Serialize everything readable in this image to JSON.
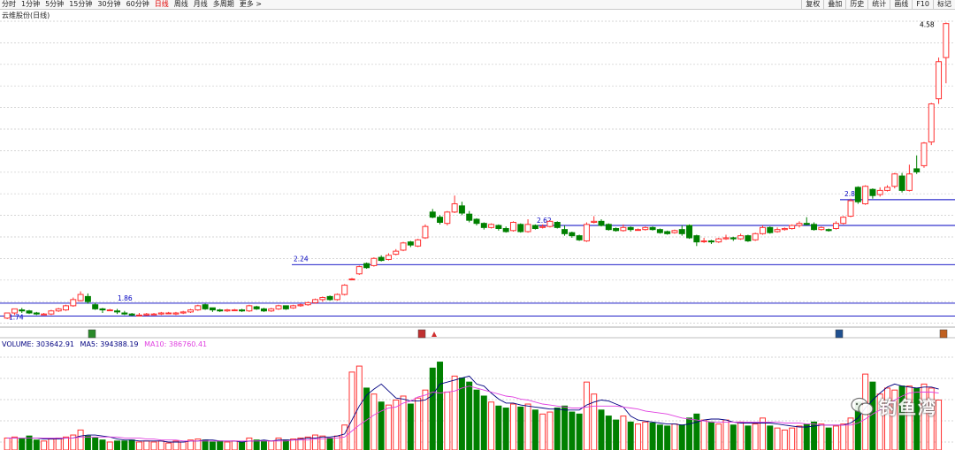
{
  "toolbar": {
    "periods": [
      "分时",
      "1分钟",
      "5分钟",
      "15分钟",
      "30分钟",
      "60分钟",
      "日线",
      "周线",
      "月线",
      "多周期",
      "更多 >"
    ],
    "active_period": "日线",
    "right_buttons": [
      "复权",
      "叠加",
      "历史",
      "统计",
      "画线",
      "F10",
      "标记"
    ]
  },
  "stock_title": "云维股份(日线)",
  "volume_legend": {
    "volume": "VOLUME: 303642.91",
    "ma5": "MA5: 394388.19",
    "ma10": "MA10: 386760.41"
  },
  "colors": {
    "up": "#ff3030",
    "down": "#008000",
    "level_line": "#0000c0",
    "ma5": "#000080",
    "ma10": "#e040e0",
    "grid": "#c8c8c8"
  },
  "watermark": "钓鱼湾",
  "chart_data": {
    "type": "candlestick",
    "title": "云维股份(日线)",
    "ylim": [
      1.65,
      4.62
    ],
    "price_annotations": [
      {
        "label": "1.74",
        "value": 1.74
      },
      {
        "label": "1.86",
        "value": 1.865
      },
      {
        "label": "2.24",
        "value": 2.24
      },
      {
        "label": "2.62",
        "value": 2.62
      },
      {
        "label": "2.88",
        "value": 2.87
      },
      {
        "label": "4.58",
        "value": 4.58
      }
    ],
    "candles": [
      [
        1.72,
        1.77,
        1.76,
        1.71
      ],
      [
        1.77,
        1.81,
        1.79,
        1.75
      ],
      [
        1.8,
        1.79,
        1.82,
        1.77
      ],
      [
        1.79,
        1.77,
        1.8,
        1.76
      ],
      [
        1.77,
        1.76,
        1.78,
        1.75
      ],
      [
        1.76,
        1.76,
        1.77,
        1.75
      ],
      [
        1.76,
        1.79,
        1.8,
        1.75
      ],
      [
        1.79,
        1.81,
        1.82,
        1.78
      ],
      [
        1.8,
        1.84,
        1.85,
        1.79
      ],
      [
        1.84,
        1.9,
        1.92,
        1.83
      ],
      [
        1.89,
        1.95,
        1.98,
        1.88
      ],
      [
        1.93,
        1.88,
        1.96,
        1.86
      ],
      [
        1.85,
        1.81,
        1.87,
        1.8
      ],
      [
        1.81,
        1.8,
        1.82,
        1.77
      ],
      [
        1.8,
        1.8,
        1.81,
        1.79
      ],
      [
        1.79,
        1.78,
        1.81,
        1.76
      ],
      [
        1.77,
        1.76,
        1.79,
        1.75
      ],
      [
        1.76,
        1.75,
        1.77,
        1.74
      ],
      [
        1.75,
        1.75,
        1.77,
        1.74
      ],
      [
        1.75,
        1.76,
        1.77,
        1.74
      ],
      [
        1.76,
        1.76,
        1.77,
        1.75
      ],
      [
        1.76,
        1.77,
        1.78,
        1.75
      ],
      [
        1.77,
        1.77,
        1.78,
        1.76
      ],
      [
        1.76,
        1.77,
        1.78,
        1.75
      ],
      [
        1.77,
        1.78,
        1.79,
        1.76
      ],
      [
        1.78,
        1.8,
        1.81,
        1.77
      ],
      [
        1.8,
        1.84,
        1.85,
        1.79
      ],
      [
        1.85,
        1.81,
        1.86,
        1.8
      ],
      [
        1.82,
        1.8,
        1.82,
        1.78
      ],
      [
        1.8,
        1.79,
        1.81,
        1.78
      ],
      [
        1.79,
        1.8,
        1.81,
        1.78
      ],
      [
        1.8,
        1.8,
        1.81,
        1.79
      ],
      [
        1.8,
        1.79,
        1.81,
        1.78
      ],
      [
        1.79,
        1.84,
        1.85,
        1.78
      ],
      [
        1.83,
        1.81,
        1.84,
        1.8
      ],
      [
        1.81,
        1.79,
        1.82,
        1.78
      ],
      [
        1.79,
        1.81,
        1.82,
        1.78
      ],
      [
        1.81,
        1.84,
        1.85,
        1.8
      ],
      [
        1.84,
        1.81,
        1.84,
        1.8
      ],
      [
        1.82,
        1.84,
        1.85,
        1.81
      ],
      [
        1.84,
        1.85,
        1.86,
        1.83
      ],
      [
        1.85,
        1.87,
        1.88,
        1.84
      ],
      [
        1.87,
        1.9,
        1.91,
        1.86
      ],
      [
        1.9,
        1.92,
        1.93,
        1.88
      ],
      [
        1.93,
        1.9,
        1.94,
        1.89
      ],
      [
        1.9,
        1.95,
        1.96,
        1.89
      ],
      [
        1.95,
        2.04,
        2.05,
        1.94
      ],
      [
        2.1,
        2.1,
        2.11,
        2.09
      ],
      [
        2.15,
        2.22,
        2.23,
        2.14
      ],
      [
        2.25,
        2.21,
        2.26,
        2.2
      ],
      [
        2.23,
        2.3,
        2.31,
        2.22
      ],
      [
        2.31,
        2.28,
        2.33,
        2.27
      ],
      [
        2.29,
        2.33,
        2.35,
        2.28
      ],
      [
        2.34,
        2.37,
        2.39,
        2.33
      ],
      [
        2.38,
        2.45,
        2.46,
        2.37
      ],
      [
        2.46,
        2.43,
        2.47,
        2.41
      ],
      [
        2.42,
        2.48,
        2.49,
        2.41
      ],
      [
        2.5,
        2.61,
        2.63,
        2.49
      ],
      [
        2.75,
        2.7,
        2.78,
        2.69
      ],
      [
        2.7,
        2.65,
        2.72,
        2.63
      ],
      [
        2.64,
        2.75,
        2.76,
        2.62
      ],
      [
        2.75,
        2.83,
        2.91,
        2.74
      ],
      [
        2.81,
        2.74,
        2.85,
        2.72
      ],
      [
        2.73,
        2.67,
        2.76,
        2.65
      ],
      [
        2.68,
        2.64,
        2.69,
        2.62
      ],
      [
        2.64,
        2.6,
        2.65,
        2.58
      ],
      [
        2.6,
        2.63,
        2.64,
        2.59
      ],
      [
        2.62,
        2.59,
        2.63,
        2.57
      ],
      [
        2.59,
        2.56,
        2.61,
        2.55
      ],
      [
        2.57,
        2.65,
        2.66,
        2.56
      ],
      [
        2.63,
        2.56,
        2.64,
        2.55
      ],
      [
        2.56,
        2.63,
        2.68,
        2.55
      ],
      [
        2.62,
        2.59,
        2.63,
        2.58
      ],
      [
        2.6,
        2.61,
        2.63,
        2.59
      ],
      [
        2.61,
        2.66,
        2.67,
        2.6
      ],
      [
        2.65,
        2.6,
        2.66,
        2.59
      ],
      [
        2.58,
        2.54,
        2.62,
        2.52
      ],
      [
        2.55,
        2.52,
        2.56,
        2.5
      ],
      [
        2.52,
        2.48,
        2.53,
        2.47
      ],
      [
        2.47,
        2.63,
        2.65,
        2.46
      ],
      [
        2.65,
        2.66,
        2.71,
        2.64
      ],
      [
        2.66,
        2.62,
        2.68,
        2.61
      ],
      [
        2.63,
        2.58,
        2.64,
        2.57
      ],
      [
        2.59,
        2.57,
        2.6,
        2.56
      ],
      [
        2.57,
        2.6,
        2.63,
        2.56
      ],
      [
        2.6,
        2.58,
        2.61,
        2.56
      ],
      [
        2.58,
        2.58,
        2.59,
        2.57
      ],
      [
        2.58,
        2.6,
        2.61,
        2.57
      ],
      [
        2.6,
        2.58,
        2.61,
        2.57
      ],
      [
        2.58,
        2.55,
        2.59,
        2.54
      ],
      [
        2.56,
        2.54,
        2.57,
        2.53
      ],
      [
        2.55,
        2.57,
        2.58,
        2.54
      ],
      [
        2.58,
        2.54,
        2.62,
        2.52
      ],
      [
        2.62,
        2.5,
        2.63,
        2.49
      ],
      [
        2.52,
        2.46,
        2.53,
        2.42
      ],
      [
        2.47,
        2.47,
        2.5,
        2.45
      ],
      [
        2.47,
        2.46,
        2.48,
        2.44
      ],
      [
        2.46,
        2.49,
        2.5,
        2.45
      ],
      [
        2.49,
        2.5,
        2.53,
        2.48
      ],
      [
        2.5,
        2.49,
        2.51,
        2.47
      ],
      [
        2.49,
        2.52,
        2.54,
        2.48
      ],
      [
        2.52,
        2.47,
        2.53,
        2.46
      ],
      [
        2.48,
        2.54,
        2.55,
        2.47
      ],
      [
        2.54,
        2.6,
        2.62,
        2.53
      ],
      [
        2.6,
        2.55,
        2.61,
        2.54
      ],
      [
        2.56,
        2.58,
        2.6,
        2.55
      ],
      [
        2.58,
        2.59,
        2.6,
        2.57
      ],
      [
        2.59,
        2.62,
        2.63,
        2.58
      ],
      [
        2.62,
        2.64,
        2.66,
        2.6
      ],
      [
        2.64,
        2.63,
        2.7,
        2.62
      ],
      [
        2.63,
        2.58,
        2.65,
        2.57
      ],
      [
        2.58,
        2.6,
        2.61,
        2.57
      ],
      [
        2.58,
        2.57,
        2.59,
        2.56
      ],
      [
        2.59,
        2.64,
        2.66,
        2.58
      ],
      [
        2.64,
        2.7,
        2.71,
        2.63
      ],
      [
        2.71,
        2.86,
        2.88,
        2.7
      ],
      [
        2.99,
        2.85,
        3.0,
        2.83
      ],
      [
        2.83,
        3.0,
        3.01,
        2.82
      ],
      [
        2.97,
        2.91,
        2.98,
        2.88
      ],
      [
        2.92,
        2.96,
        2.99,
        2.9
      ],
      [
        2.96,
        2.99,
        3.01,
        2.95
      ],
      [
        3.0,
        3.12,
        3.13,
        2.98
      ],
      [
        3.1,
        2.96,
        3.13,
        2.94
      ],
      [
        2.96,
        3.12,
        3.21,
        2.95
      ],
      [
        3.17,
        3.14,
        3.3,
        3.12
      ],
      [
        3.2,
        3.42,
        3.43,
        3.18
      ],
      [
        3.43,
        3.8,
        3.81,
        3.4
      ],
      [
        3.85,
        4.21,
        4.25,
        3.8
      ],
      [
        4.25,
        4.58,
        4.59,
        4.0
      ]
    ],
    "volumes": [
      12,
      13,
      11,
      14,
      10,
      9,
      11,
      12,
      13,
      15,
      20,
      14,
      12,
      10,
      8,
      9,
      9,
      10,
      8,
      9,
      8,
      9,
      7,
      9,
      8,
      10,
      11,
      10,
      8,
      9,
      8,
      9,
      8,
      12,
      10,
      9,
      9,
      12,
      10,
      11,
      12,
      13,
      15,
      14,
      12,
      14,
      25,
      78,
      84,
      62,
      56,
      48,
      45,
      50,
      54,
      46,
      52,
      60,
      82,
      88,
      58,
      74,
      72,
      68,
      60,
      54,
      48,
      44,
      42,
      46,
      43,
      46,
      40,
      36,
      38,
      42,
      44,
      38,
      36,
      68,
      56,
      40,
      34,
      30,
      34,
      28,
      26,
      28,
      27,
      25,
      24,
      26,
      25,
      32,
      36,
      30,
      28,
      26,
      30,
      25,
      28,
      24,
      26,
      32,
      24,
      22,
      20,
      22,
      24,
      26,
      28,
      26,
      22,
      24,
      26,
      32,
      48,
      76,
      68,
      56,
      62,
      60,
      64,
      64,
      62,
      66,
      62,
      50
    ],
    "ma5": [
      12,
      12,
      12,
      12,
      12,
      11,
      11,
      11,
      12,
      12,
      14,
      15,
      15,
      14,
      13,
      11,
      10,
      10,
      9,
      9,
      9,
      9,
      8,
      8,
      8,
      9,
      9,
      10,
      10,
      9,
      9,
      9,
      8,
      9,
      9,
      10,
      9,
      10,
      10,
      10,
      11,
      12,
      12,
      13,
      13,
      14,
      16,
      30,
      44,
      55,
      61,
      66,
      59,
      52,
      51,
      49,
      49,
      50,
      55,
      66,
      68,
      70,
      72,
      74,
      66,
      64,
      57,
      51,
      47,
      47,
      45,
      44,
      43,
      42,
      41,
      41,
      40,
      40,
      40,
      45,
      48,
      50,
      49,
      46,
      43,
      34,
      30,
      29,
      28,
      27,
      26,
      26,
      25,
      26,
      28,
      30,
      31,
      31,
      30,
      28,
      27,
      27,
      27,
      27,
      27,
      26,
      25,
      24,
      23,
      23,
      24,
      25,
      25,
      25,
      25,
      27,
      32,
      42,
      50,
      57,
      63,
      66,
      64,
      63,
      62,
      63,
      63,
      61
    ],
    "ma10": [
      12,
      12,
      12,
      12,
      12,
      12,
      12,
      12,
      12,
      12,
      13,
      13,
      13,
      13,
      13,
      13,
      12,
      12,
      12,
      11,
      11,
      10,
      10,
      10,
      9,
      9,
      9,
      9,
      9,
      9,
      9,
      9,
      9,
      9,
      9,
      9,
      9,
      9,
      9,
      10,
      10,
      10,
      11,
      11,
      12,
      12,
      13,
      19,
      25,
      30,
      35,
      39,
      42,
      43,
      47,
      49,
      53,
      55,
      58,
      57,
      58,
      59,
      62,
      64,
      62,
      60,
      58,
      56,
      54,
      53,
      51,
      50,
      48,
      46,
      45,
      44,
      43,
      42,
      42,
      43,
      44,
      44,
      44,
      44,
      43,
      42,
      41,
      39,
      38,
      37,
      36,
      34,
      32,
      31,
      30,
      29,
      28,
      28,
      28,
      28,
      28,
      28,
      28,
      28,
      28,
      28,
      27,
      27,
      27,
      26,
      26,
      25,
      25,
      25,
      25,
      25,
      27,
      31,
      36,
      40,
      45,
      50,
      54,
      57,
      58,
      58,
      58,
      57
    ],
    "volume_axis_max": 100
  }
}
